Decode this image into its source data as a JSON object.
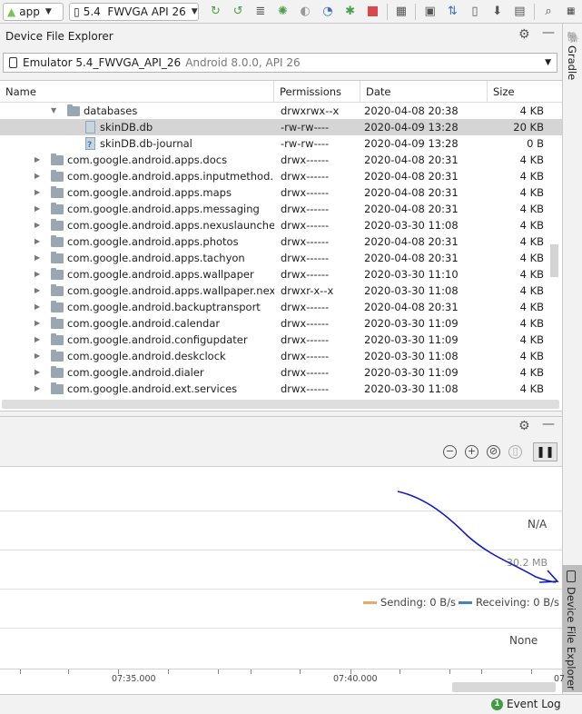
{
  "toolbar": {
    "app_config": "app",
    "device": "5.4  FWVGA API 26",
    "icons": [
      "android-icon",
      "device-icon",
      "rerun-icon",
      "apply-changes-icon",
      "apply-code-icon",
      "sync-icon",
      "debug-icon",
      "attach-debugger-icon",
      "profile-icon",
      "coverage-icon",
      "stop-icon",
      "project-structure-icon",
      "terminal-icon",
      "sdk-manager-icon",
      "avd-manager-icon",
      "layout-inspector-icon",
      "search-icon",
      "more-icon"
    ]
  },
  "side": {
    "gradle_label": "Gradle",
    "dfe_label": "Device File Explorer"
  },
  "explorer": {
    "title": "Device File Explorer",
    "device_name": "Emulator 5.4_FWVGA_API_26",
    "device_version": "Android 8.0.0, API 26",
    "columns": [
      "Name",
      "Permissions",
      "Date",
      "Size"
    ],
    "rows": [
      {
        "name": "databases",
        "perm": "drwxrwx--x",
        "date": "2020-04-08 20:38",
        "size": "4 KB",
        "type": "folder-open",
        "level": 1
      },
      {
        "name": "skinDB.db",
        "perm": "-rw-rw----",
        "date": "2020-04-09 13:28",
        "size": "20 KB",
        "type": "file",
        "level": 2,
        "selected": true
      },
      {
        "name": "skinDB.db-journal",
        "perm": "-rw-rw----",
        "date": "2020-04-09 13:28",
        "size": "0 B",
        "type": "file-unknown",
        "level": 2
      },
      {
        "name": "com.google.android.apps.docs",
        "perm": "drwx------",
        "date": "2020-04-08 20:31",
        "size": "4 KB",
        "type": "folder",
        "level": 0
      },
      {
        "name": "com.google.android.apps.inputmethod.hin",
        "perm": "drwx------",
        "date": "2020-04-08 20:31",
        "size": "4 KB",
        "type": "folder",
        "level": 0
      },
      {
        "name": "com.google.android.apps.maps",
        "perm": "drwx------",
        "date": "2020-04-08 20:31",
        "size": "4 KB",
        "type": "folder",
        "level": 0
      },
      {
        "name": "com.google.android.apps.messaging",
        "perm": "drwx------",
        "date": "2020-04-08 20:31",
        "size": "4 KB",
        "type": "folder",
        "level": 0
      },
      {
        "name": "com.google.android.apps.nexuslauncher",
        "perm": "drwx------",
        "date": "2020-03-30 11:08",
        "size": "4 KB",
        "type": "folder",
        "level": 0
      },
      {
        "name": "com.google.android.apps.photos",
        "perm": "drwx------",
        "date": "2020-04-08 20:31",
        "size": "4 KB",
        "type": "folder",
        "level": 0
      },
      {
        "name": "com.google.android.apps.tachyon",
        "perm": "drwx------",
        "date": "2020-04-08 20:31",
        "size": "4 KB",
        "type": "folder",
        "level": 0
      },
      {
        "name": "com.google.android.apps.wallpaper",
        "perm": "drwx------",
        "date": "2020-03-30 11:10",
        "size": "4 KB",
        "type": "folder",
        "level": 0
      },
      {
        "name": "com.google.android.apps.wallpaper.nexus",
        "perm": "drwxr-x--x",
        "date": "2020-03-30 11:08",
        "size": "4 KB",
        "type": "folder",
        "level": 0
      },
      {
        "name": "com.google.android.backuptransport",
        "perm": "drwx------",
        "date": "2020-04-08 20:31",
        "size": "4 KB",
        "type": "folder",
        "level": 0
      },
      {
        "name": "com.google.android.calendar",
        "perm": "drwx------",
        "date": "2020-03-30 11:09",
        "size": "4 KB",
        "type": "folder",
        "level": 0
      },
      {
        "name": "com.google.android.configupdater",
        "perm": "drwx------",
        "date": "2020-03-30 11:09",
        "size": "4 KB",
        "type": "folder",
        "level": 0
      },
      {
        "name": "com.google.android.deskclock",
        "perm": "drwx------",
        "date": "2020-03-30 11:08",
        "size": "4 KB",
        "type": "folder",
        "level": 0
      },
      {
        "name": "com.google.android.dialer",
        "perm": "drwx------",
        "date": "2020-03-30 11:09",
        "size": "4 KB",
        "type": "folder",
        "level": 0
      },
      {
        "name": "com.google.android.ext.services",
        "perm": "drwx------",
        "date": "2020-03-30 11:08",
        "size": "4 KB",
        "type": "folder",
        "level": 0
      }
    ]
  },
  "profiler": {
    "lanes": {
      "cpu": "N/A",
      "memory": "30.2 MB",
      "energy": "None"
    },
    "legend": {
      "sending": "Sending: 0 B/s",
      "receiving": "Receiving: 0 B/s",
      "sending_color": "#e8a866",
      "receiving_color": "#4a80c8"
    },
    "time_labels": [
      "07:35.000",
      "07:40.000",
      "07"
    ]
  },
  "status": {
    "event_log": "Event Log"
  },
  "colors": {
    "selection": "#d5d5d5",
    "annotation_stroke": "#1018c8"
  }
}
